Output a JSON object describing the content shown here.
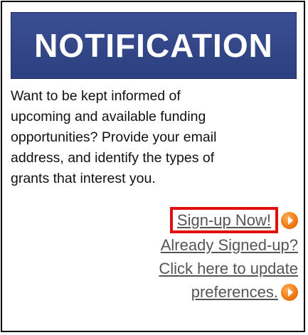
{
  "banner": {
    "title": "NOTIFICATION"
  },
  "message": {
    "lines": [
      "Want to be kept informed of",
      "upcoming and available funding",
      "opportunities? Provide your email",
      "address, and identify the types of",
      "grants that interest you."
    ]
  },
  "links": {
    "signup": "Sign-up Now!",
    "update_line1": "Already Signed-up?",
    "update_line2": "Click here to update",
    "update_line3": "preferences."
  },
  "icons": {
    "arrow": "orange-circle-arrow-icon"
  },
  "colors": {
    "banner": "#2f4385",
    "highlight": "#e01010",
    "link": "#555555",
    "arrow": "#f07a16"
  }
}
